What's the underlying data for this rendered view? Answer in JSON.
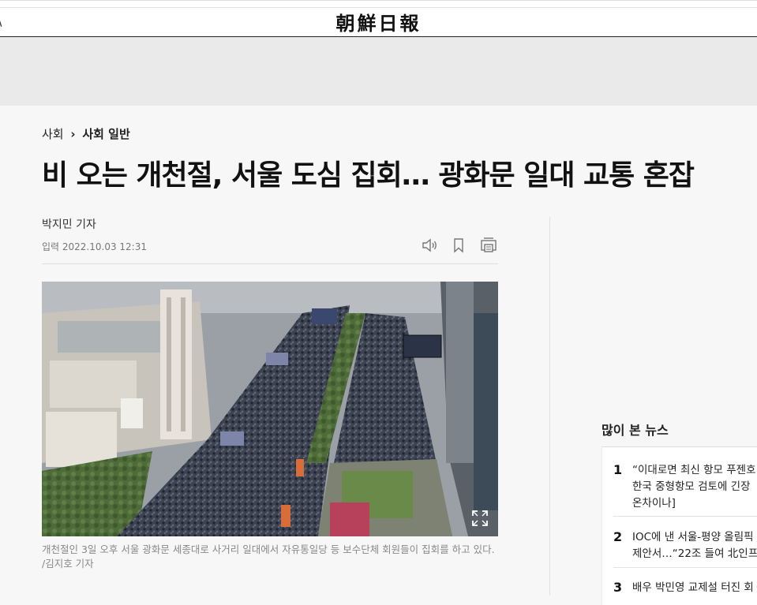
{
  "masthead": {
    "logo_text": "朝鮮日報",
    "back_glyph": "\\"
  },
  "article": {
    "breadcrumb": {
      "section": "사회",
      "separator": "›",
      "subsection": "사회 일반"
    },
    "headline": "비 오는 개천절, 서울 도심 집회… 광화문 일대 교통 혼잡",
    "reporter": "박지민 기자",
    "published": "입력 2022.10.03 12:31",
    "tools": [
      "speaker-icon",
      "bookmark-icon",
      "print-icon"
    ],
    "photo_caption": "개천절인 3일 오후 서울 광화문 세종대로 사거리 일대에서 자유통일당 등 보수단체 회원들이 집회를 하고 있다. /김지호 기자"
  },
  "most_viewed": {
    "title": "많이 본 뉴스",
    "items": [
      {
        "rank": "1",
        "lines": [
          "“이대로면 최신 항모 푸젠호",
          "한국 중형항모 검토에 긴장",
          "온차이나]"
        ]
      },
      {
        "rank": "2",
        "lines": [
          "IOC에 낸 서울-평양 올림픽",
          "제안서…“22조 들여 北인프"
        ]
      },
      {
        "rank": "3",
        "lines": [
          "배우 박민영 교제설 터진 회"
        ]
      }
    ]
  },
  "colors": {
    "background": "#f7f7f7",
    "ad_band": "#eaeaea",
    "text": "#111111",
    "muted": "#888888"
  }
}
